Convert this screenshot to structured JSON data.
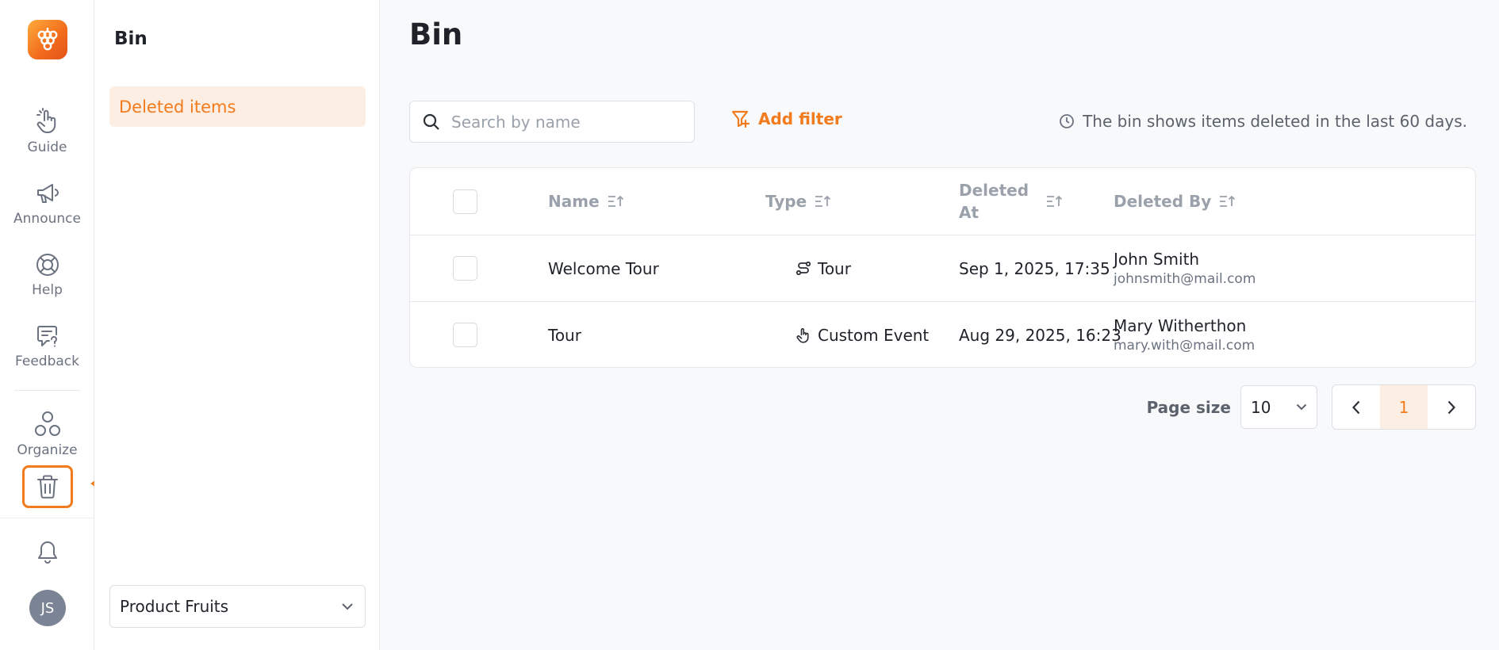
{
  "rail": {
    "items": [
      {
        "label": "Guide",
        "icon": "pointer-hand-icon"
      },
      {
        "label": "Announce",
        "icon": "megaphone-icon"
      },
      {
        "label": "Help",
        "icon": "lifebuoy-icon"
      },
      {
        "label": "Feedback",
        "icon": "feedback-icon"
      },
      {
        "label": "Organize",
        "icon": "organize-icon"
      }
    ],
    "avatar_initials": "JS",
    "accent_color": "#f27b1d"
  },
  "subnav": {
    "title": "Bin",
    "items": [
      {
        "label": "Deleted items",
        "active": true
      }
    ],
    "workspace": "Product Fruits"
  },
  "main": {
    "title": "Bin",
    "search": {
      "placeholder": "Search by name",
      "value": ""
    },
    "add_filter_label": "Add filter",
    "info_text": "The bin shows items deleted in the last 60 days.",
    "table": {
      "columns": {
        "name": "Name",
        "type": "Type",
        "deleted_at_1": "Deleted",
        "deleted_at_2": "At",
        "deleted_by": "Deleted By"
      },
      "rows": [
        {
          "name": "Welcome Tour",
          "type": "Tour",
          "type_icon": "tour-icon",
          "deleted_at": "Sep 1, 2025, 17:35",
          "deleted_by_name": "John Smith",
          "deleted_by_email": "johnsmith@mail.com"
        },
        {
          "name": "Tour",
          "type": "Custom Event",
          "type_icon": "custom-event-icon",
          "deleted_at": "Aug 29, 2025, 16:23",
          "deleted_by_name": "Mary Witherthon",
          "deleted_by_email": "mary.with@mail.com"
        }
      ]
    },
    "pagination": {
      "page_size_label": "Page size",
      "page_size": "10",
      "current_page": "1"
    }
  }
}
